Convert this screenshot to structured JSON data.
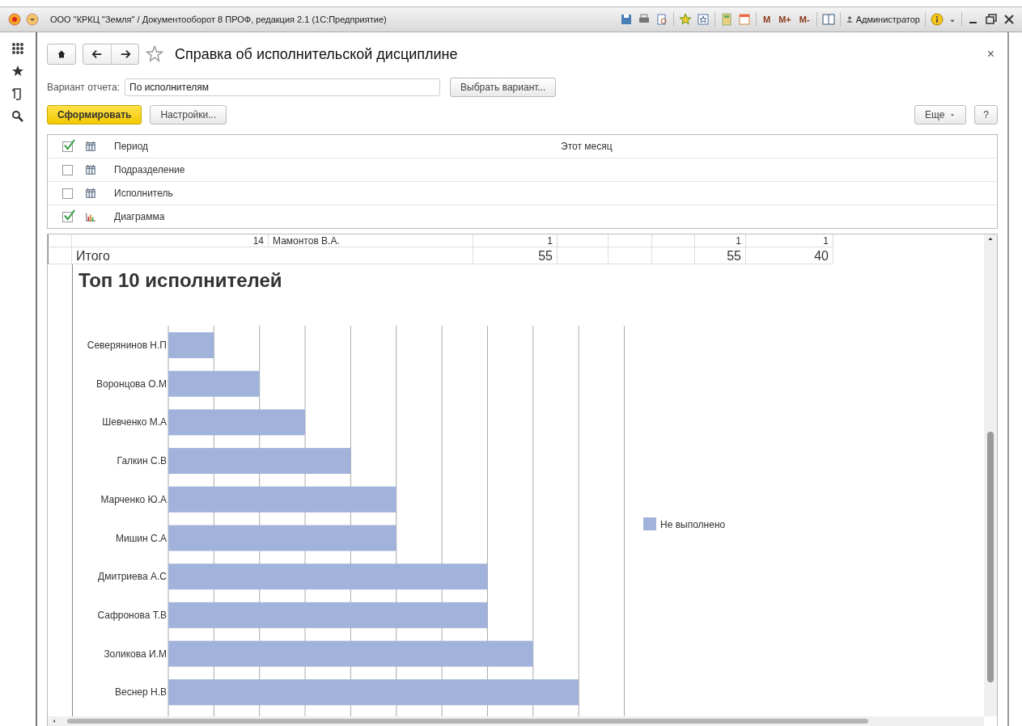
{
  "window": {
    "title": "ООО \"КРКЦ \"Земля\" / Документооборот 8 ПРОФ, редакция 2.1  (1С:Предприятие)",
    "memory_buttons": [
      "M",
      "M+",
      "M-"
    ],
    "user": "Администратор"
  },
  "form": {
    "title": "Справка об исполнительской дисциплине",
    "close": "×",
    "variant_label": "Вариант отчета:",
    "variant_value": "По исполнителям",
    "choose_button": "Выбрать вариант...",
    "generate_button": "Сформировать",
    "settings_button": "Настройки...",
    "more_button": "Еще",
    "help_button": "?"
  },
  "filters": [
    {
      "kind": "list",
      "label": "Период",
      "value": "Этот месяц",
      "checked": true
    },
    {
      "kind": "list",
      "label": "Подразделение",
      "checked": false
    },
    {
      "kind": "list",
      "label": "Исполнитель",
      "checked": false
    },
    {
      "kind": "chart",
      "label": "Диаграмма",
      "checked": true
    }
  ],
  "report": {
    "rows": [
      {
        "kind": "detail",
        "number": "14",
        "name": "Мамонтов В.А.",
        "cells": [
          "1",
          null,
          null,
          null,
          "1",
          "1"
        ]
      },
      {
        "kind": "total",
        "name": "Итого",
        "cells": [
          "55",
          null,
          null,
          null,
          "55",
          "40"
        ]
      }
    ]
  },
  "chart": {
    "title": "Топ 10 исполнителей",
    "categories": [
      "Северянинов Н.П",
      "Воронцова О.М",
      "Шевченко М.А",
      "Галкин С.В",
      "Марченко Ю.А",
      "Мишин С.А",
      "Дмитриева А.С",
      "Сафронова Т.В",
      "Золикова И.М",
      "Веснер Н.В"
    ],
    "legend": "Не выполнено"
  }
}
